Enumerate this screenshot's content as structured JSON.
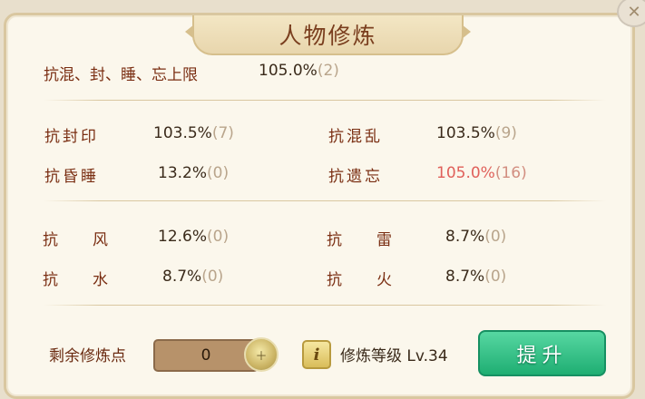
{
  "window": {
    "title": "人物修炼"
  },
  "summary": {
    "label": "抗混、封、睡、忘上限",
    "value": "105.0%",
    "count": "(2)"
  },
  "resist_rows": [
    {
      "label": "抗封印",
      "value": "103.5%",
      "count": "(7)"
    },
    {
      "label": "抗混乱",
      "value": "103.5%",
      "count": "(9)"
    },
    {
      "label": "抗昏睡",
      "value": "13.2%",
      "count": "(0)"
    },
    {
      "label": "抗遗忘",
      "value": "105.0%",
      "count": "(16)"
    }
  ],
  "element_rows": [
    {
      "label_a": "抗",
      "label_b": "风",
      "value": "12.6%",
      "count": "(0)"
    },
    {
      "label_a": "抗",
      "label_b": "雷",
      "value": "8.7%",
      "count": "(0)"
    },
    {
      "label_a": "抗",
      "label_b": "水",
      "value": "8.7%",
      "count": "(0)"
    },
    {
      "label_a": "抗",
      "label_b": "火",
      "value": "8.7%",
      "count": "(0)"
    }
  ],
  "points": {
    "label": "剩余修炼点",
    "value": "0",
    "icon": "coin-add-icon"
  },
  "level": {
    "text": "修炼等级 Lv.34",
    "icon": "info-icon"
  },
  "buttons": {
    "upgrade": "提升",
    "close_icon": "close-icon"
  },
  "colors": {
    "highlight": "#e0605a",
    "button": "#1fae72"
  }
}
